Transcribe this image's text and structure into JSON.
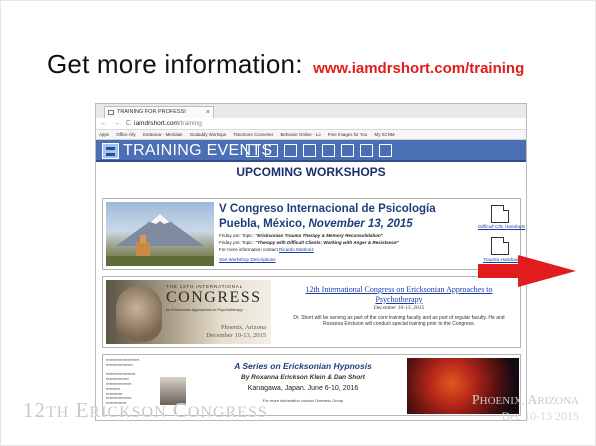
{
  "heading": {
    "text": "Get more information:",
    "url": "www.iamdrshort.com/training"
  },
  "browser": {
    "tab_title": "TRAINING FOR PROFESSI",
    "tab_close": "×",
    "nav_glyphs": "← → C",
    "url_host": "iamdrshort.com",
    "url_path": "/training",
    "bookmarks": [
      "Apps",
      "Office Ally",
      "Endeavor - Meridian",
      "Godaddy Workspa",
      "TimeZone Converter",
      "Behavior Online - Lo",
      "Free Images for You",
      "My SCNM"
    ]
  },
  "site": {
    "banner_title": "TRAINING EVENTS",
    "subheading": "UPCOMING WORKSHOPS",
    "card1": {
      "title": "V Congreso Internacional de Psicología",
      "location": "Puebla, México,",
      "date": "November 13, 2015",
      "friday_am_label": "Friday am: Topic:",
      "friday_am_topic": "\"Ericksonian Trauma Therapy & Memory Reconsolidation\"",
      "friday_pm_label": "Friday pm: Topic:",
      "friday_pm_topic": "\"Therapy with Difficult Clients: Working with Anger & Resistance\"",
      "contact_label": "For more information contact",
      "contact_name": "Ricardo Martinez",
      "link": "See Workshop Descriptions",
      "handout1": "Difficult Clts Handouts",
      "handout2": "Trauma Handouts"
    },
    "card2": {
      "image_intl": "THE 12TH INTERNATIONAL",
      "image_congress": "CONGRESS",
      "image_approaches": "on Ericksonian Approaches to Psychotherapy",
      "image_city": "Phoenix, Arizona",
      "image_dates": "December 10-13, 2015",
      "title": "12th International Congress on Ericksonian Approaches to Psychotherapy",
      "date": "December 10-13, 2015",
      "description": "Dr. Short will be serving as part of the core training faculty and as part of regular faculty. He and Roxanna Erickson will conduct special training prior to the Congress."
    },
    "card3": {
      "title": "A Series on Ericksonian Hypnosis",
      "by": "By Roxanna Erickson Klein & Dan Short",
      "place": "Kanagawa, Japan. June 6-10, 2016",
      "contact": "For more information contact Oneness Group"
    }
  },
  "footer": {
    "left_prefix": "12",
    "left_th": "TH",
    "left_e": "E",
    "left_rickson": "RICKSON",
    "left_c": "C",
    "left_ongress": "ONGRESS",
    "right_p": "P",
    "right_hoenix": "HOENIX,",
    "right_a": "A",
    "right_rizona": "RIZONA",
    "right_date": "Dec 10-13 2015"
  },
  "colors": {
    "url_red": "#e31b1b",
    "banner_blue": "#4a6fb5",
    "arrow_red": "#e11c1c",
    "footer_gray": "#cfc7c7"
  },
  "icons": [
    "arrow-right-icon",
    "document-icon",
    "calendar-icon"
  ]
}
